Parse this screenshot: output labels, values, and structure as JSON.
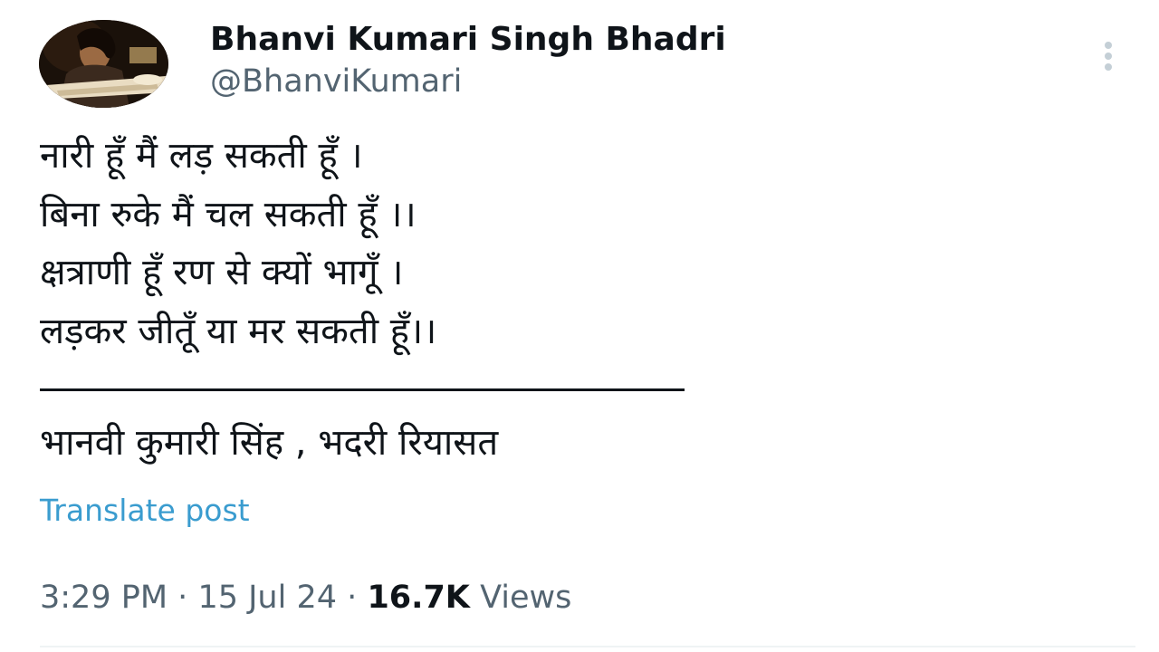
{
  "author": {
    "display_name": "Bhanvi Kumari Singh Bhadri",
    "handle": "@BhanviKumari",
    "avatar_icon": "profile-photo"
  },
  "menu": {
    "icon": "more-vertical-icon"
  },
  "post": {
    "lines": [
      "नारी हूँ मैं लड़ सकती हूँ ।",
      "बिना रुके मैं चल सकती हूँ ।।",
      "क्षत्राणी हूँ रण से क्यों भागूँ ।",
      "लड़कर जीतूँ या मर सकती हूँ।।"
    ],
    "signature": "भानवी कुमारी सिंह , भदरी रियासत"
  },
  "translate": {
    "label": "Translate post",
    "color": "#3a9ccf"
  },
  "meta": {
    "time": "3:29 PM",
    "separator": "·",
    "date": "15 Jul 24",
    "views_count": "16.7K",
    "views_label": "Views"
  },
  "colors": {
    "text_primary": "#0f1419",
    "text_secondary": "#536471",
    "link": "#3a9ccf",
    "divider": "#eff3f4"
  }
}
